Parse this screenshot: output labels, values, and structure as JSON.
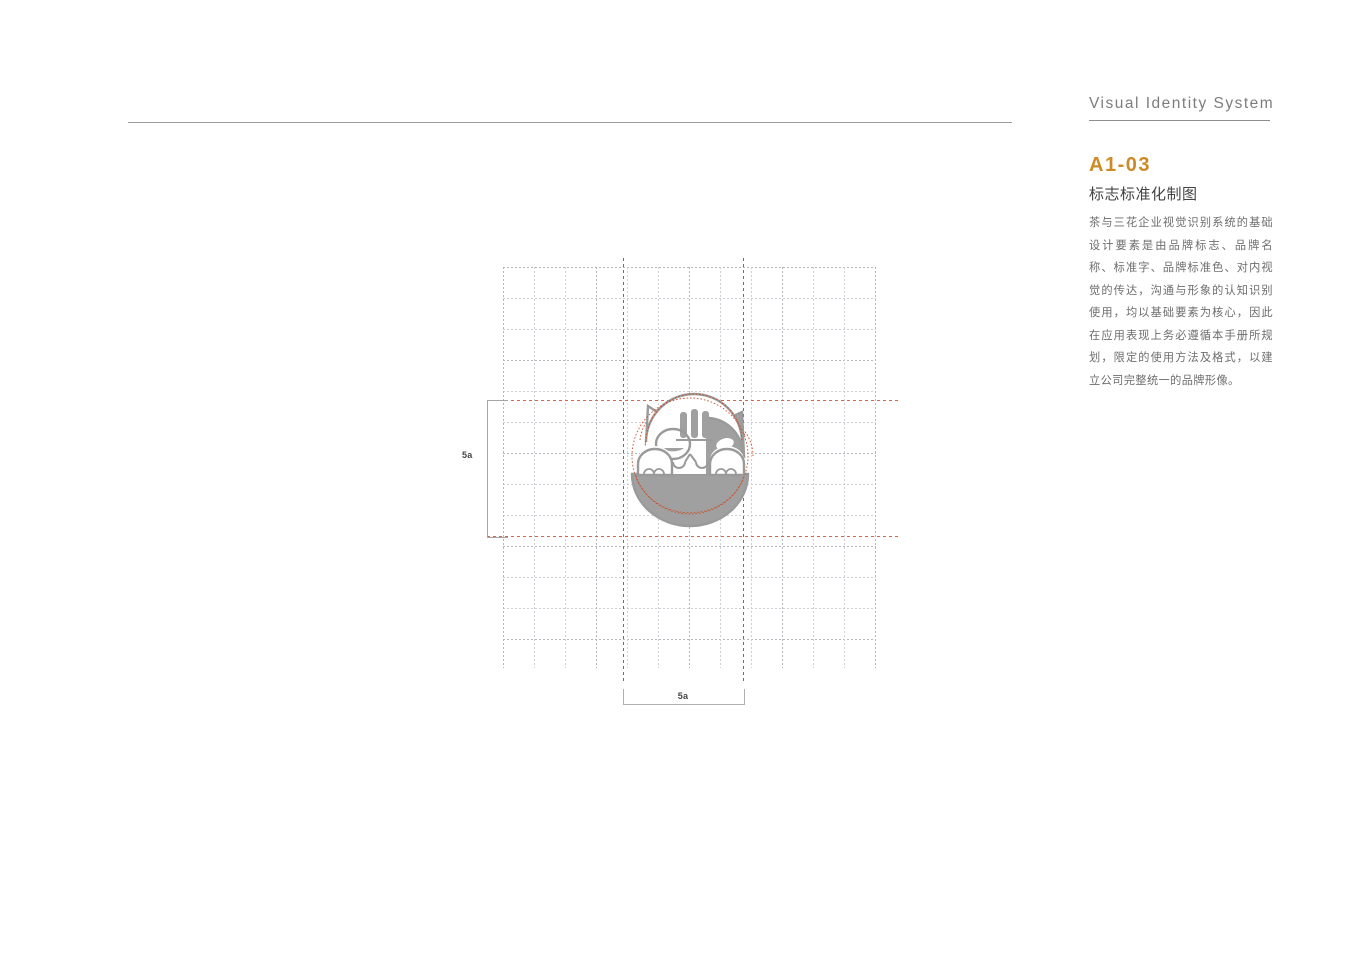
{
  "header": {
    "system_title": "Visual Identity System"
  },
  "section": {
    "code": "A1-03",
    "code_color": "#cd8b26",
    "subtitle": "标志标准化制图",
    "body": "茶与三花企业视觉识别系统的基础设计要素是由品牌标志、品牌名称、标准字、品牌标准色、对内视觉的传达，沟通与形象的认知识别使用，均以基础要素为核心，因此在应用表现上务必遵循本手册所规划，限定的使用方法及格式，以建立公司完整统一的品牌形像。"
  },
  "diagram": {
    "dimension_vertical_label": "5a",
    "dimension_horizontal_label": "5a",
    "grid": {
      "columns": 12,
      "rows": 13,
      "cell_size_px": 31,
      "line_color": "#cfcfd6",
      "major_line_color": "#b6b6bd"
    },
    "guides": {
      "color": "#c8502c",
      "vertical_x": [
        623,
        743
      ],
      "horizontal_y": [
        400,
        536
      ]
    },
    "logo": {
      "name": "cat-in-bowl-logo",
      "fill_color": "#a0a0a0",
      "outline_color": "#9a9a9a",
      "construction_arc_color": "#c8502c"
    }
  }
}
